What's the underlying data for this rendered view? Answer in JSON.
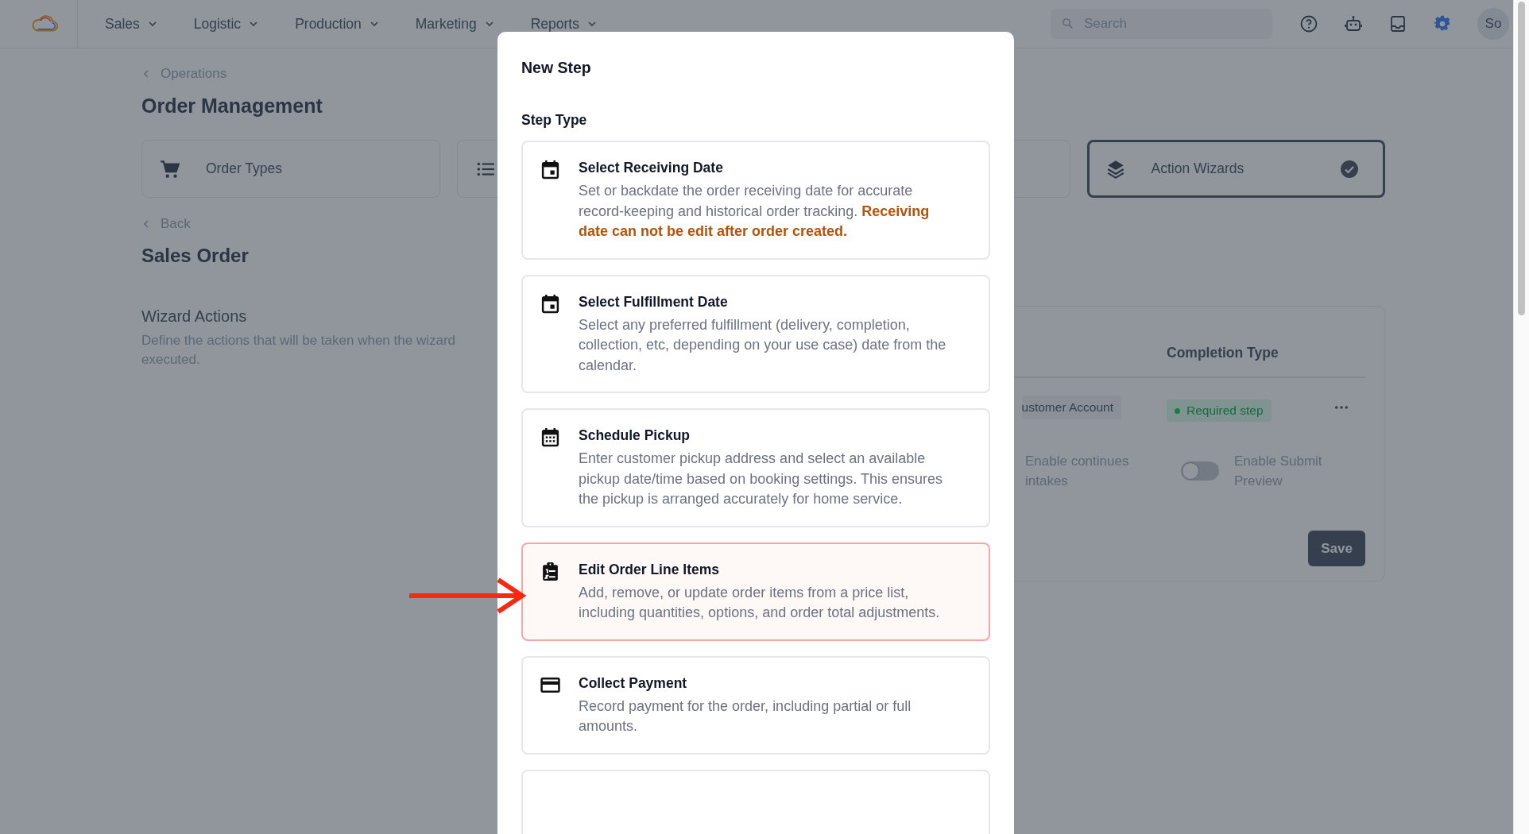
{
  "topbar": {
    "nav": [
      {
        "label": "Sales"
      },
      {
        "label": "Logistic"
      },
      {
        "label": "Production"
      },
      {
        "label": "Marketing"
      },
      {
        "label": "Reports"
      }
    ],
    "search": {
      "placeholder": "Search"
    },
    "avatar": "So"
  },
  "breadcrumb": "Operations",
  "title": "Order Management",
  "categories": [
    {
      "kind": "cart",
      "label": "Order Types",
      "selected": false
    },
    {
      "kind": "list",
      "selected": false
    },
    {
      "kind": "blank",
      "selected": false
    },
    {
      "kind": "layers",
      "label": "Action Wizards",
      "selected": true
    }
  ],
  "back": "Back",
  "subtitle": "Sales Order",
  "wizard_actions": {
    "title": "Wizard Actions",
    "description_lines": [
      "Define the actions that will be taken when the wizard",
      "executed."
    ]
  },
  "panel": {
    "column_header": "Completion Type",
    "row": {
      "account": "ustomer Account",
      "completion": "Required step"
    },
    "toggle_label_left": "Enable continues intakes",
    "toggle": {
      "label": "Enable Submit Preview",
      "on": false
    },
    "save": "Save"
  },
  "modal": {
    "title": "New Step",
    "section": "Step Type",
    "options": [
      {
        "kind": "calendar",
        "title": "Select Receiving Date",
        "description": "Set or backdate the order receiving date for accurate record-keeping and historical order tracking. **Receiving date can not be edit after order created.**",
        "selected": false
      },
      {
        "kind": "calendar",
        "title": "Select Fulfillment Date",
        "description": "Select any preferred fulfillment (delivery, completion, collection, etc, depending on your use case) date from the calendar.",
        "selected": false
      },
      {
        "kind": "schedule",
        "title": "Schedule Pickup",
        "description": "Enter customer pickup address and select an available pickup date/time based on booking settings. This ensures the pickup is arranged accurately for home service.",
        "selected": false
      },
      {
        "kind": "items",
        "title": "Edit Order Line Items",
        "description": "Add, remove, or update order items from a price list, including quantities, options, and order total adjustments.",
        "selected": true
      },
      {
        "kind": "payment",
        "title": "Collect Payment",
        "description": "Record payment for the order, including partial or full amounts.",
        "selected": false
      },
      {
        "kind": "blank",
        "selected": false
      }
    ]
  }
}
